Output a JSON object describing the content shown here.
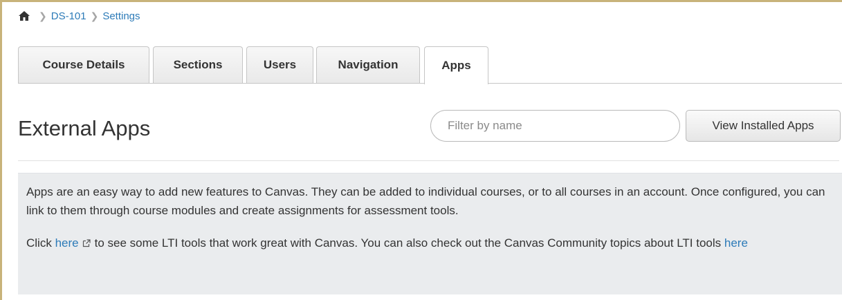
{
  "breadcrumb": {
    "home_icon": "home-icon",
    "items": [
      "DS-101",
      "Settings"
    ]
  },
  "tabs": [
    {
      "label": "Course Details",
      "active": false
    },
    {
      "label": "Sections",
      "active": false
    },
    {
      "label": "Users",
      "active": false
    },
    {
      "label": "Navigation",
      "active": false
    },
    {
      "label": "Apps",
      "active": true
    }
  ],
  "page": {
    "title": "External Apps",
    "filter_placeholder": "Filter by name",
    "view_installed_label": "View Installed Apps"
  },
  "info": {
    "paragraph1": "Apps are an easy way to add new features to Canvas. They can be added to individual courses, or to all courses in an account. Once configured, you can link to them through course modules and create assignments for assessment tools.",
    "p2_prefix": "Click ",
    "p2_link1": "here",
    "p2_link1_icon": "external-link-icon",
    "p2_middle": "to see some LTI tools that work great with Canvas. You can also check out the Canvas Community topics about LTI tools ",
    "p2_link2": "here"
  },
  "colors": {
    "link": "#2d7bb8",
    "panel_background": "#eaecee",
    "frame": "#c8b37a"
  }
}
